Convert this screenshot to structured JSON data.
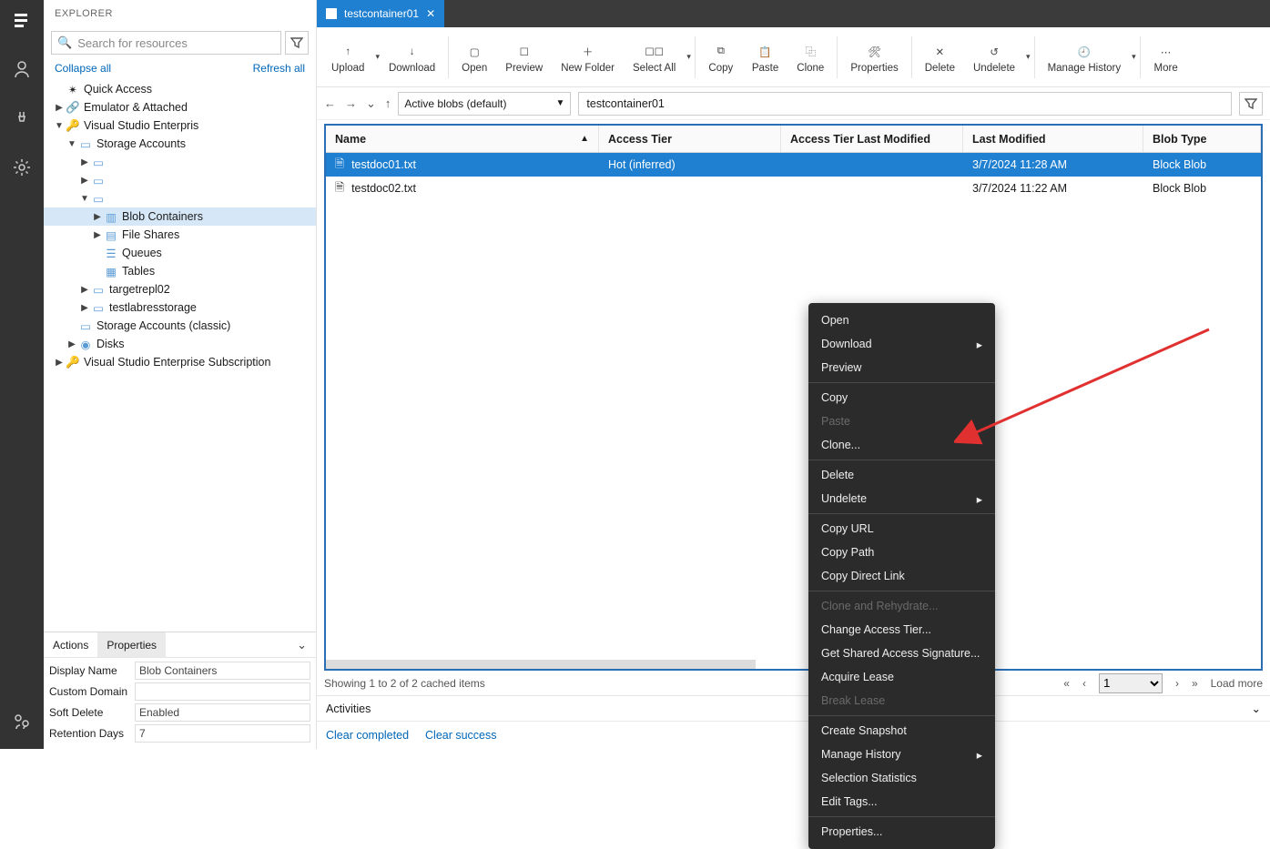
{
  "activity_bar": {
    "top_label": "explorer"
  },
  "explorer": {
    "title": "EXPLORER",
    "search_placeholder": "Search for resources",
    "collapse_all": "Collapse all",
    "refresh_all": "Refresh all",
    "tree": {
      "quick_access": "Quick Access",
      "emulator": "Emulator & Attached",
      "vs_enterprise": "Visual Studio Enterpris",
      "storage_accounts": "Storage Accounts",
      "blob_containers": "Blob Containers",
      "file_shares": "File Shares",
      "queues": "Queues",
      "tables": "Tables",
      "targetrepl": "targetrepl02",
      "testlabress": "testlabresstorage",
      "storage_classic": "Storage Accounts (classic)",
      "disks": "Disks",
      "vs_sub": "Visual Studio Enterprise Subscription"
    }
  },
  "props": {
    "tab_actions": "Actions",
    "tab_properties": "Properties",
    "rows": {
      "display_name": {
        "label": "Display Name",
        "value": "Blob Containers"
      },
      "custom_domain": {
        "label": "Custom Domain",
        "value": ""
      },
      "soft_delete": {
        "label": "Soft Delete",
        "value": "Enabled"
      },
      "retention": {
        "label": "Retention Days",
        "value": "7"
      }
    }
  },
  "tab": {
    "name": "testcontainer01"
  },
  "toolbar": {
    "upload": "Upload",
    "download": "Download",
    "open": "Open",
    "preview": "Preview",
    "new_folder": "New Folder",
    "select_all": "Select All",
    "copy": "Copy",
    "paste": "Paste",
    "clone": "Clone",
    "properties": "Properties",
    "delete": "Delete",
    "undelete": "Undelete",
    "manage_history": "Manage History",
    "more": "More"
  },
  "nav": {
    "view": "Active blobs (default)",
    "path": "testcontainer01"
  },
  "table": {
    "headers": {
      "name": "Name",
      "access_tier": "Access Tier",
      "atlm": "Access Tier Last Modified",
      "lm": "Last Modified",
      "bt": "Blob Type"
    },
    "rows": [
      {
        "name": "testdoc01.txt",
        "access_tier": "Hot (inferred)",
        "atlm": "",
        "lm": "3/7/2024 11:28 AM",
        "bt": "Block Blob"
      },
      {
        "name": "testdoc02.txt",
        "access_tier": "",
        "atlm": "",
        "lm": "3/7/2024 11:22 AM",
        "bt": "Block Blob"
      }
    ]
  },
  "pager": {
    "status": "Showing 1 to 2 of 2 cached items",
    "page": "1",
    "load_more": "Load more"
  },
  "activities": {
    "title": "Activities",
    "clear_completed": "Clear completed",
    "clear_successful": "Clear success"
  },
  "ctx": {
    "open": "Open",
    "download": "Download",
    "preview": "Preview",
    "copy": "Copy",
    "paste": "Paste",
    "clone": "Clone...",
    "delete": "Delete",
    "undelete": "Undelete",
    "copy_url": "Copy URL",
    "copy_path": "Copy Path",
    "copy_direct": "Copy Direct Link",
    "clone_rehydrate": "Clone and Rehydrate...",
    "change_tier": "Change Access Tier...",
    "sas": "Get Shared Access Signature...",
    "acquire_lease": "Acquire Lease",
    "break_lease": "Break Lease",
    "snapshot": "Create Snapshot",
    "manage_history": "Manage History",
    "selection_stats": "Selection Statistics",
    "edit_tags": "Edit Tags...",
    "properties": "Properties..."
  }
}
